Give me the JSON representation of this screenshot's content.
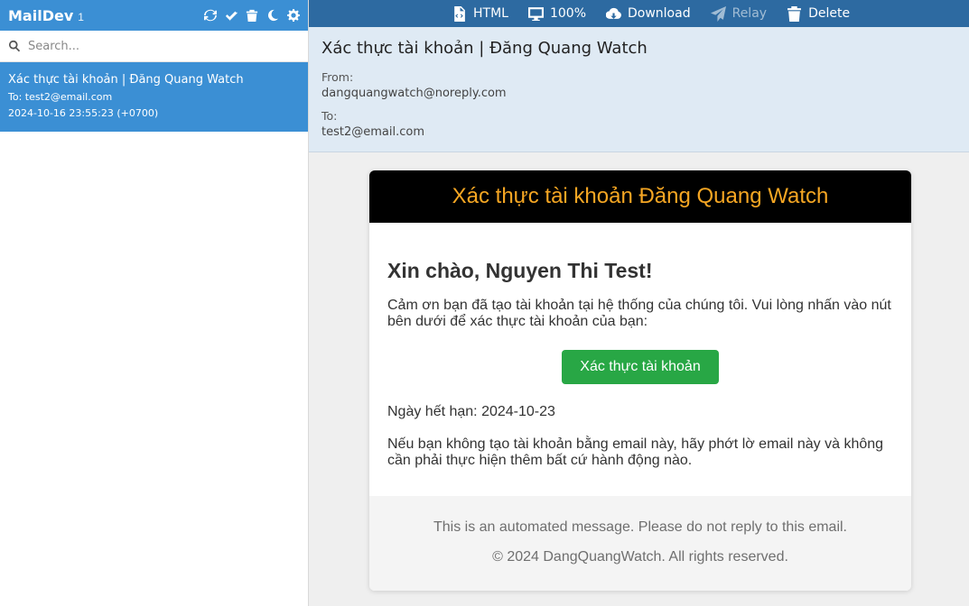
{
  "app": {
    "title": "MailDev",
    "count": "1"
  },
  "sidebar": {
    "tools": [
      "refresh-icon",
      "mark-all-read-icon",
      "trash-icon",
      "moon-icon",
      "gear-icon"
    ],
    "search": {
      "placeholder": "Search..."
    },
    "emails": [
      {
        "subject": "Xác thực tài khoản | Đăng Quang Watch",
        "to": "To: test2@email.com",
        "date": "2024-10-16 23:55:23 (+0700)"
      }
    ]
  },
  "toolbar": {
    "html": "HTML",
    "zoom": "100%",
    "download": "Download",
    "relay": "Relay",
    "delete": "Delete"
  },
  "message": {
    "subject": "Xác thực tài khoản | Đăng Quang Watch",
    "from_label": "From:",
    "from": "dangquangwatch@noreply.com",
    "to_label": "To:",
    "to": "test2@email.com"
  },
  "email_body": {
    "header": "Xác thực tài khoản Đăng Quang Watch",
    "greeting": "Xin chào, Nguyen Thi Test!",
    "intro": "Cảm ơn bạn đã tạo tài khoản tại hệ thống của chúng tôi. Vui lòng nhấn vào nút bên dưới để xác thực tài khoản của bạn:",
    "button": "Xác thực tài khoản",
    "expiry": "Ngày hết hạn: 2024-10-23",
    "notice": "Nếu bạn không tạo tài khoản bằng email này, hãy phớt lờ email này và không cần phải thực hiện thêm bất cứ hành động nào.",
    "footer_line1": "This is an automated message. Please do not reply to this email.",
    "footer_line2": "© 2024 DangQuangWatch. All rights reserved."
  },
  "colors": {
    "sidebar_header": "#3b8fd4",
    "toolbar": "#2d6aa1",
    "meta_bg": "#dfeaf4",
    "email_header_text": "#f5a623",
    "cta": "#28a745"
  }
}
